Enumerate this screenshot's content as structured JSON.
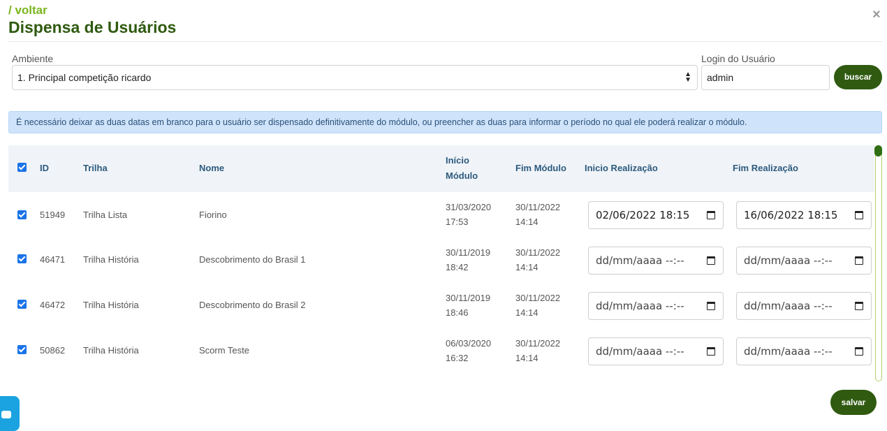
{
  "header": {
    "back_label": "/ voltar",
    "title": "Dispensa de Usuários",
    "close_label": "×"
  },
  "filters": {
    "ambiente_label": "Ambiente",
    "ambiente_value": "1. Principal competição ricardo",
    "login_label": "Login do Usuário",
    "login_value": "admin",
    "search_button": "buscar"
  },
  "alert_text": "É necessário deixar as duas datas em branco para o usuário ser dispensado definitivamente do módulo, ou preencher as duas para informar o período no qual ele poderá realizar o módulo.",
  "table": {
    "columns": {
      "id": "ID",
      "trilha": "Trilha",
      "nome": "Nome",
      "inicio_modulo_1": "Início",
      "inicio_modulo_2": "Módulo",
      "fim_modulo": "Fim Módulo",
      "inicio_realizacao": "Inicio Realização",
      "fim_realizacao": "Fim Realização"
    },
    "rows": [
      {
        "checked": true,
        "id": "51949",
        "trilha": "Trilha Lista",
        "nome": "Fiorino",
        "inicio_date": "31/03/2020",
        "inicio_time": "17:53",
        "fim_date": "30/11/2022",
        "fim_time": "14:14",
        "inicio_realizacao": "02/06/2022 18:15",
        "fim_realizacao": "16/06/2022 18:15"
      },
      {
        "checked": true,
        "id": "46471",
        "trilha": "Trilha História",
        "nome": "Descobrimento do Brasil 1",
        "inicio_date": "30/11/2019",
        "inicio_time": "18:42",
        "fim_date": "30/11/2022",
        "fim_time": "14:14",
        "inicio_realizacao": "dd/mm/aaaa --:--",
        "fim_realizacao": "dd/mm/aaaa --:--"
      },
      {
        "checked": true,
        "id": "46472",
        "trilha": "Trilha História",
        "nome": "Descobrimento do Brasil 2",
        "inicio_date": "30/11/2019",
        "inicio_time": "18:46",
        "fim_date": "30/11/2022",
        "fim_time": "14:14",
        "inicio_realizacao": "dd/mm/aaaa --:--",
        "fim_realizacao": "dd/mm/aaaa --:--"
      },
      {
        "checked": true,
        "id": "50862",
        "trilha": "Trilha História",
        "nome": "Scorm Teste",
        "inicio_date": "06/03/2020",
        "inicio_time": "16:32",
        "fim_date": "30/11/2022",
        "fim_time": "14:14",
        "inicio_realizacao": "dd/mm/aaaa --:--",
        "fim_realizacao": "dd/mm/aaaa --:--"
      }
    ]
  },
  "save_button": "salvar",
  "colors": {
    "brand_dark_green": "#2f5a10",
    "link_green": "#7ab51d",
    "alert_bg": "#cfe4fb",
    "header_text": "#2d5a7e",
    "checkbox": "#1a73e8",
    "chat_fab": "#1aa3e0"
  },
  "icons": {
    "close": "close-icon",
    "select": "select-arrows-icon",
    "calendar": "calendar-icon",
    "chat": "chat-icon"
  }
}
